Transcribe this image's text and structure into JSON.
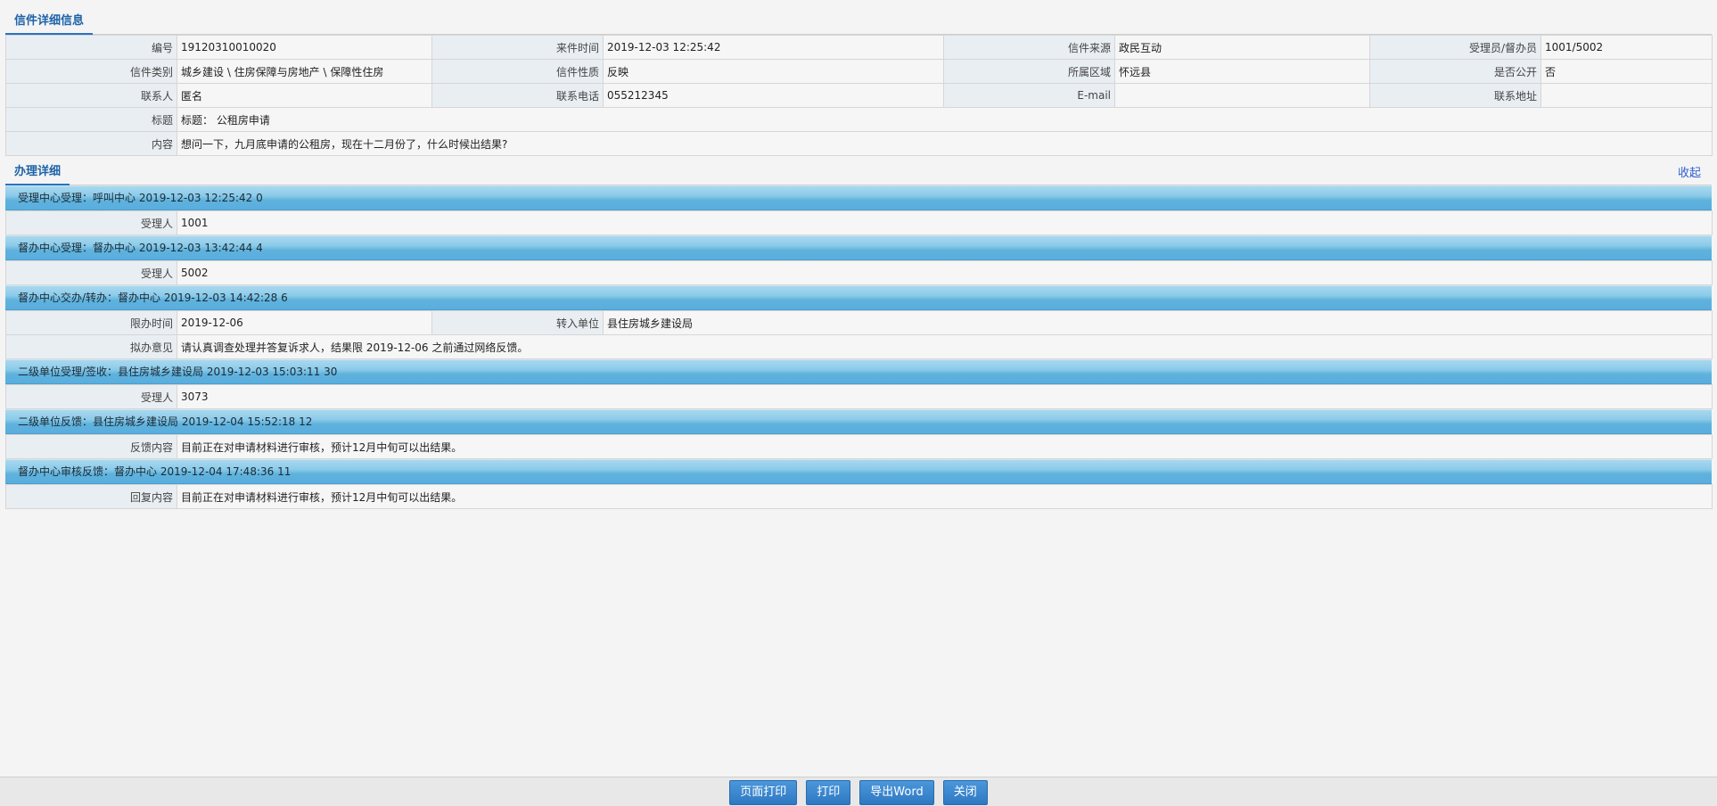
{
  "tabs": {
    "letter_detail": "信件详细信息",
    "handling_detail": "办理详细",
    "collapse": "收起"
  },
  "letter": {
    "rows": [
      [
        {
          "label": "编号",
          "value": "19120310010020"
        },
        {
          "label": "来件时间",
          "value": "2019-12-03 12:25:42"
        },
        {
          "label": "信件来源",
          "value": "政民互动"
        },
        {
          "label": "受理员/督办员",
          "value": "1001/5002"
        }
      ],
      [
        {
          "label": "信件类别",
          "value": "城乡建设 \\ 住房保障与房地产 \\ 保障性住房"
        },
        {
          "label": "信件性质",
          "value": "反映"
        },
        {
          "label": "所属区域",
          "value": "怀远县"
        },
        {
          "label": "是否公开",
          "value": "否"
        }
      ],
      [
        {
          "label": "联系人",
          "value": "匿名"
        },
        {
          "label": "联系电话",
          "value": "055212345"
        },
        {
          "label": "E-mail",
          "value": ""
        },
        {
          "label": "联系地址",
          "value": ""
        }
      ]
    ],
    "title_label": "标题",
    "title_value": "标题： 公租房申请",
    "content_label": "内容",
    "content_value": "想问一下，九月底申请的公租房，现在十二月份了，什么时候出结果?"
  },
  "stages": [
    {
      "header": "受理中心受理：呼叫中心 2019-12-03 12:25:42 0",
      "rows": [
        {
          "label": "受理人",
          "value": "1001"
        }
      ]
    },
    {
      "header": "督办中心受理：督办中心 2019-12-03 13:42:44 4",
      "rows": [
        {
          "label": "受理人",
          "value": "5002"
        }
      ]
    },
    {
      "header": "督办中心交办/转办：督办中心 2019-12-03 14:42:28 6",
      "rows": [
        {
          "label": "限办时间",
          "value": "2019-12-06",
          "label2": "转入单位",
          "value2": "县住房城乡建设局"
        },
        {
          "label": "拟办意见",
          "value": "请认真调查处理并答复诉求人，结果限 2019-12-06 之前通过网络反馈。"
        }
      ]
    },
    {
      "header": "二级单位受理/签收：县住房城乡建设局 2019-12-03 15:03:11 30",
      "rows": [
        {
          "label": "受理人",
          "value": "3073"
        }
      ]
    },
    {
      "header": "二级单位反馈：县住房城乡建设局 2019-12-04 15:52:18 12",
      "rows": [
        {
          "label": "反馈内容",
          "value": "目前正在对申请材料进行审核，预计12月中旬可以出结果。"
        }
      ]
    },
    {
      "header": "督办中心审核反馈：督办中心 2019-12-04 17:48:36 11",
      "rows": [
        {
          "label": "回复内容",
          "value": "目前正在对申请材料进行审核，预计12月中旬可以出结果。"
        }
      ]
    }
  ],
  "buttons": {
    "page_print": "页面打印",
    "print": "打印",
    "export_word": "导出Word",
    "close": "关闭"
  }
}
